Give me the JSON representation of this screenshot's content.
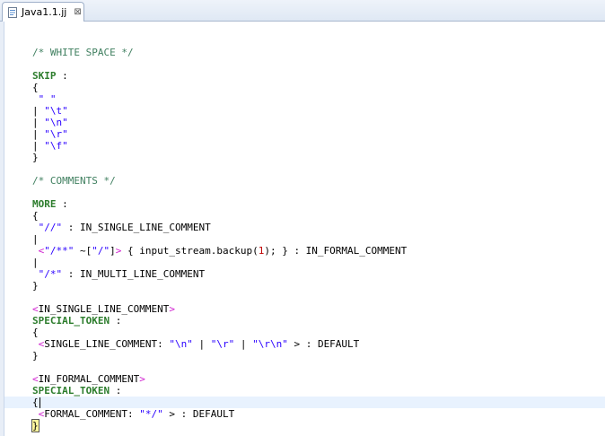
{
  "tab": {
    "title": "Java1.1.jj",
    "close_glyph": "⊠"
  },
  "code": {
    "l1": "/* WHITE SPACE */",
    "skip_kw": "SKIP",
    "skip_rest": " :",
    "open_brace": "{",
    "close_brace": "}",
    "sp_str": "\" \"",
    "t_str": "\"\\t\"",
    "n_str": "\"\\n\"",
    "r_str": "\"\\r\"",
    "f_str": "\"\\f\"",
    "bar": "|",
    "l_comments": "/* COMMENTS */",
    "more_kw": "MORE",
    "more_rest": " :",
    "slc_str": "\"//\"",
    "slc_rest": " : IN_SINGLE_LINE_COMMENT",
    "lt": "<",
    "gt": ">",
    "fc_str1": "\"/**\"",
    "fc_tilde": " ~[",
    "fc_str2": "\"/\"",
    "fc_rb": "]",
    "fc_rest1": " { input_stream.backup(",
    "fc_num": "1",
    "fc_rest2": "); } : IN_FORMAL_COMMENT",
    "mlc_str": "\"/*\"",
    "mlc_rest": " : IN_MULTI_LINE_COMMENT",
    "state_slc": "IN_SINGLE_LINE_COMMENT",
    "special_kw": "SPECIAL_TOKEN",
    "special_rest": " :",
    "slc_tok": "SINGLE_LINE_COMMENT: ",
    "sep_bar": " | ",
    "rn_str": "\"\\r\\n\"",
    "default_rest": " > : DEFAULT",
    "state_fc": "IN_FORMAL_COMMENT",
    "fc_tok": "FORMAL_COMMENT: ",
    "end_str": "\"*/\"",
    "default_rest2": " > : DEFAULT",
    "sp": " "
  }
}
